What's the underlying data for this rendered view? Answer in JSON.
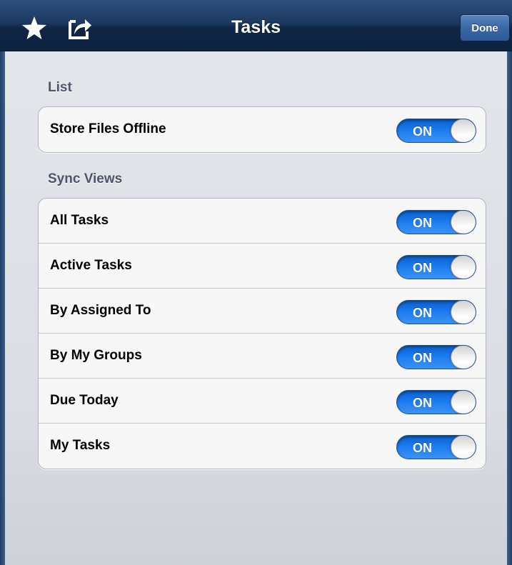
{
  "navbar": {
    "title": "Tasks",
    "done_label": "Done",
    "left_icons": [
      "star-icon",
      "share-icon"
    ]
  },
  "sections": [
    {
      "header": "List",
      "rows": [
        {
          "label": "Store Files Offline",
          "switch_label": "ON",
          "on": true
        }
      ]
    },
    {
      "header": "Sync Views",
      "rows": [
        {
          "label": "All Tasks",
          "switch_label": "ON",
          "on": true
        },
        {
          "label": "Active Tasks",
          "switch_label": "ON",
          "on": true
        },
        {
          "label": "By Assigned To",
          "switch_label": "ON",
          "on": true
        },
        {
          "label": "By My Groups",
          "switch_label": "ON",
          "on": true
        },
        {
          "label": "Due Today",
          "switch_label": "ON",
          "on": true
        },
        {
          "label": "My Tasks",
          "switch_label": "ON",
          "on": true
        }
      ]
    }
  ],
  "colors": {
    "navbar": "#0f2745",
    "switch_on": "#1a7af0",
    "background": "#dadde3"
  }
}
